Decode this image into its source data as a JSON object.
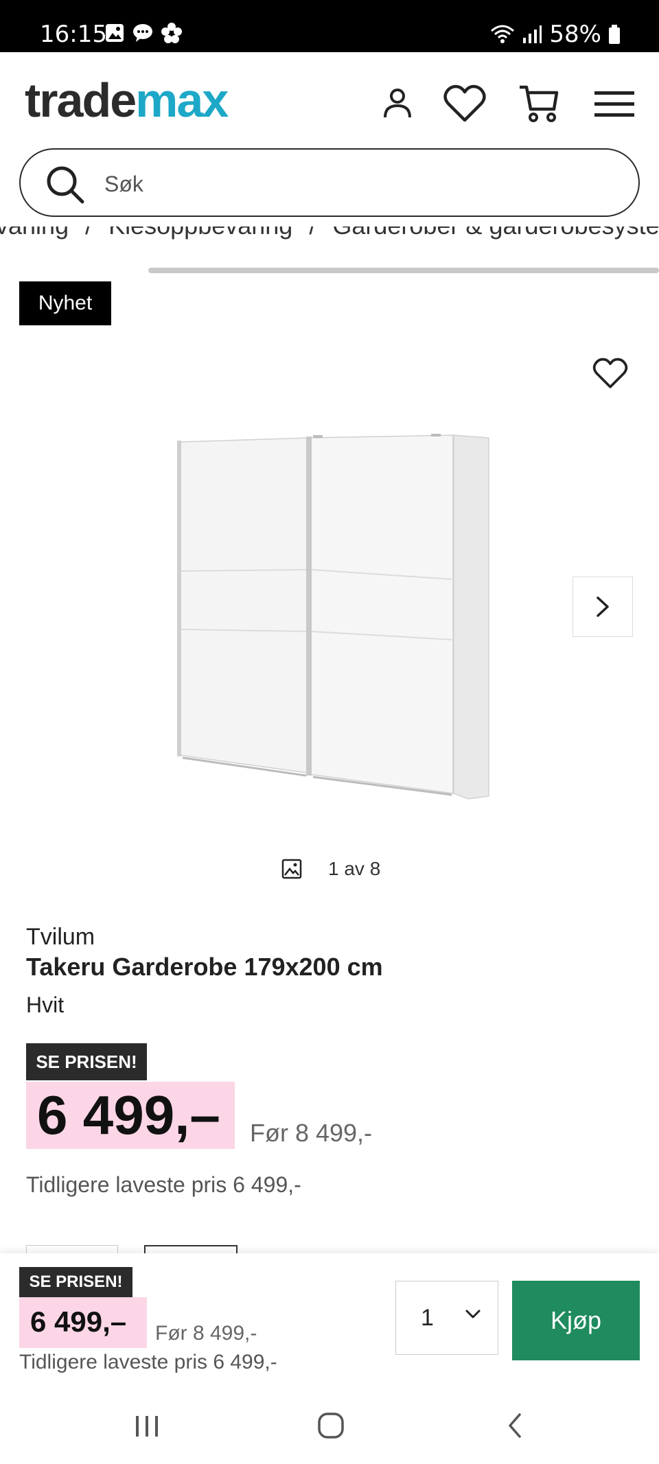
{
  "status_bar": {
    "time": "16:15",
    "battery": "58%"
  },
  "header": {
    "logo_part1": "trade",
    "logo_part2": "max",
    "icons": [
      "user-icon",
      "heart-icon",
      "cart-icon",
      "menu-icon"
    ]
  },
  "search": {
    "placeholder": "Søk"
  },
  "breadcrumb": {
    "items": [
      "vaning",
      "Klesoppbevaring",
      "Garderober & garderobesystem"
    ]
  },
  "badge": {
    "label": "Nyhet"
  },
  "gallery": {
    "counter": "1 av 8"
  },
  "product": {
    "brand": "Tvilum",
    "title": "Takeru Garderobe 179x200 cm",
    "variant": "Hvit",
    "promo_label": "SE PRISEN!",
    "price": "6 499,–",
    "before_price": "Før 8 499,-",
    "previous_lowest": "Tidligere laveste pris 6 499,-"
  },
  "buy_bar": {
    "promo_label": "SE PRISEN!",
    "price": "6 499,–",
    "before_price": "Før 8 499,-",
    "previous_lowest": "Tidligere laveste pris 6 499,-",
    "quantity": "1",
    "buy_label": "Kjøp"
  },
  "colors": {
    "accent_green": "#1f8b5e",
    "price_pink": "#fcd6e6",
    "logo_blue": "#1ea8c8"
  }
}
